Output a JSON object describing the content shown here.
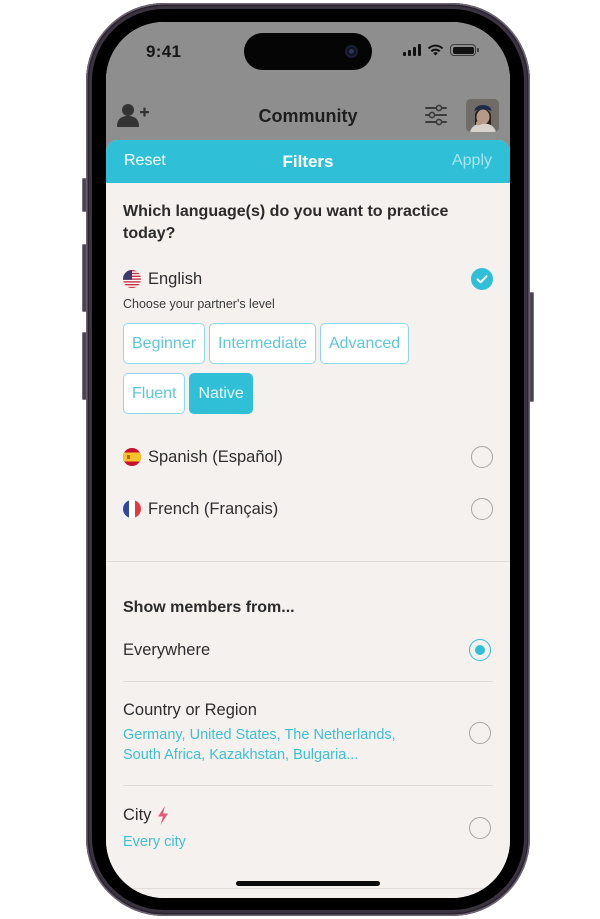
{
  "status_bar": {
    "time": "9:41",
    "icons": [
      "cellular-signal-icon",
      "wifi-icon",
      "battery-icon"
    ]
  },
  "navbar": {
    "title": "Community",
    "left_icon": "add-friend-icon",
    "right_icons": [
      "filter-sliders-icon",
      "profile-avatar"
    ]
  },
  "filters": {
    "header": {
      "reset_label": "Reset",
      "title": "Filters",
      "apply_label": "Apply"
    },
    "language_section": {
      "title": "Which language(s) do you want to practice today?",
      "languages": [
        {
          "label": "English",
          "flag": "us-flag-icon",
          "selected": true
        },
        {
          "label": "Spanish (Español)",
          "flag": "spain-flag-icon",
          "selected": false
        },
        {
          "label": "French (Français)",
          "flag": "france-flag-icon",
          "selected": false
        }
      ],
      "level_hint": "Choose your partner's level",
      "levels": [
        {
          "label": "Beginner",
          "active": false
        },
        {
          "label": "Intermediate",
          "active": false
        },
        {
          "label": "Advanced",
          "active": false
        },
        {
          "label": "Fluent",
          "active": false
        },
        {
          "label": "Native",
          "active": true
        }
      ]
    },
    "members_section": {
      "title": "Show members from...",
      "options": [
        {
          "label": "Everywhere",
          "selected": true
        },
        {
          "label": "Country or Region",
          "sub": "Germany, United States, The Netherlands, South Africa, Kazakhstan, Bulgaria...",
          "selected": false
        },
        {
          "label": "City",
          "badge_icon": "lightning-bolt-icon",
          "sub": "Every city",
          "selected": false
        }
      ]
    }
  },
  "colors": {
    "accent": "#2fc0d8",
    "apply_disabled": "#a7e4ee",
    "sheet_background": "#f5f1ef",
    "dim_overlay": "#8e8e8e",
    "lightning": "#e8547a"
  }
}
